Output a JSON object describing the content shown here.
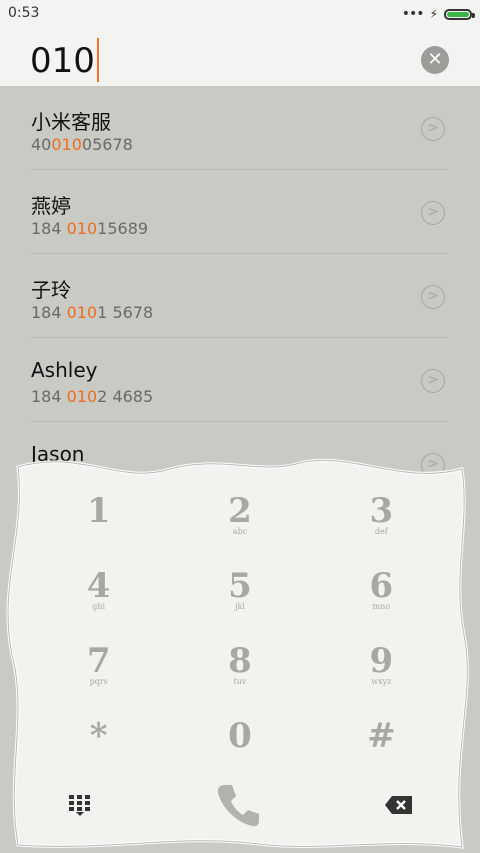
{
  "status_bar": {
    "time": "0:53"
  },
  "search": {
    "query": "010"
  },
  "results": [
    {
      "name": "小米客服",
      "num_pre": "40",
      "num_match": "010",
      "num_post": "05678"
    },
    {
      "name": "燕婷",
      "num_pre": "184 ",
      "num_match": "010",
      "num_post": "15689"
    },
    {
      "name": "子玲",
      "num_pre": "184 ",
      "num_match": "010",
      "num_post": "1 5678"
    },
    {
      "name": "Ashley",
      "num_pre": "184 ",
      "num_match": "010",
      "num_post": "2 4685"
    },
    {
      "name": "Jason",
      "num_pre": "",
      "num_match": "",
      "num_post": ""
    }
  ],
  "dialpad": {
    "keys": [
      {
        "digit": "1",
        "letters": ""
      },
      {
        "digit": "2",
        "letters": "abc"
      },
      {
        "digit": "3",
        "letters": "def"
      },
      {
        "digit": "4",
        "letters": "ghi"
      },
      {
        "digit": "5",
        "letters": "jkl"
      },
      {
        "digit": "6",
        "letters": "mno"
      },
      {
        "digit": "7",
        "letters": "pqrs"
      },
      {
        "digit": "8",
        "letters": "tuv"
      },
      {
        "digit": "9",
        "letters": "wxyz"
      },
      {
        "digit": "*",
        "letters": ""
      },
      {
        "digit": "0",
        "letters": ""
      },
      {
        "digit": "#",
        "letters": ""
      }
    ]
  },
  "colors": {
    "highlight": "#ef6d1f",
    "accent_battery": "#39b54a"
  }
}
